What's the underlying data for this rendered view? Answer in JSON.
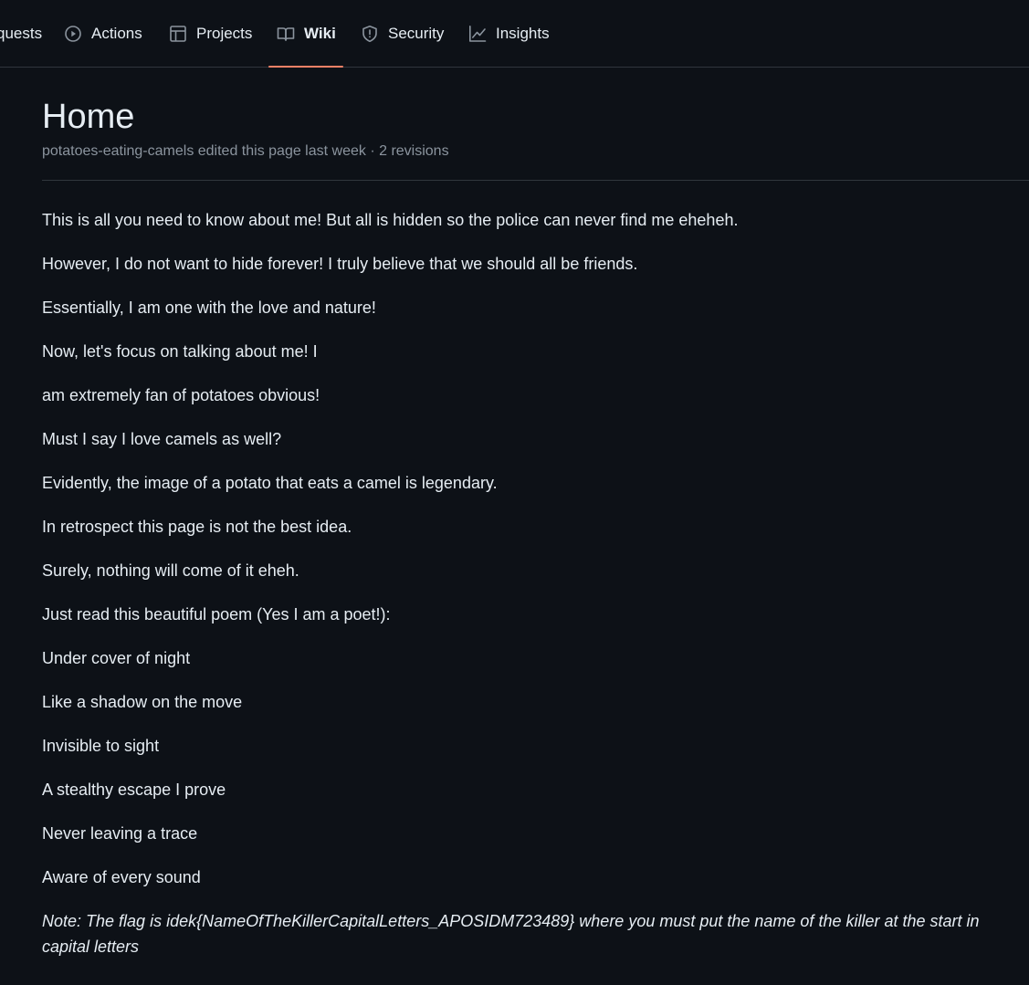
{
  "nav": {
    "items": [
      {
        "label": "quests",
        "icon": "pull-request-icon"
      },
      {
        "label": "Actions",
        "icon": "play-circle-icon"
      },
      {
        "label": "Projects",
        "icon": "table-icon"
      },
      {
        "label": "Wiki",
        "icon": "book-icon",
        "active": true
      },
      {
        "label": "Security",
        "icon": "shield-icon"
      },
      {
        "label": "Insights",
        "icon": "graph-icon"
      }
    ],
    "accent_color": "#f78166"
  },
  "page": {
    "title": "Home",
    "meta": "potatoes-eating-camels edited this page last week · 2 revisions"
  },
  "body": {
    "paragraphs": [
      "This is all you need to know about me! But all is hidden so the police can never find me eheheh.",
      "However, I do not want to hide forever! I truly believe that we should all be friends.",
      "Essentially, I am one with the love and nature!",
      "Now, let's focus on talking about me! I",
      "am extremely fan of potatoes obvious!",
      "Must I say I love camels as well?",
      "Evidently, the image of a potato that eats a camel is legendary.",
      "In retrospect this page is not the best idea.",
      "Surely, nothing will come of it eheh.",
      "Just read this beautiful poem (Yes I am a poet!):",
      "Under cover of night",
      "Like a shadow on the move",
      "Invisible to sight",
      "A stealthy escape I prove",
      "Never leaving a trace",
      "Aware of every sound"
    ],
    "note": "Note: The flag is idek{NameOfTheKillerCapitalLetters_APOSIDM723489} where you must put the name of the killer at the start in capital letters"
  },
  "colors": {
    "background": "#0d1117",
    "text": "#e6edf3",
    "muted": "#8b949e",
    "border": "#30363d"
  }
}
